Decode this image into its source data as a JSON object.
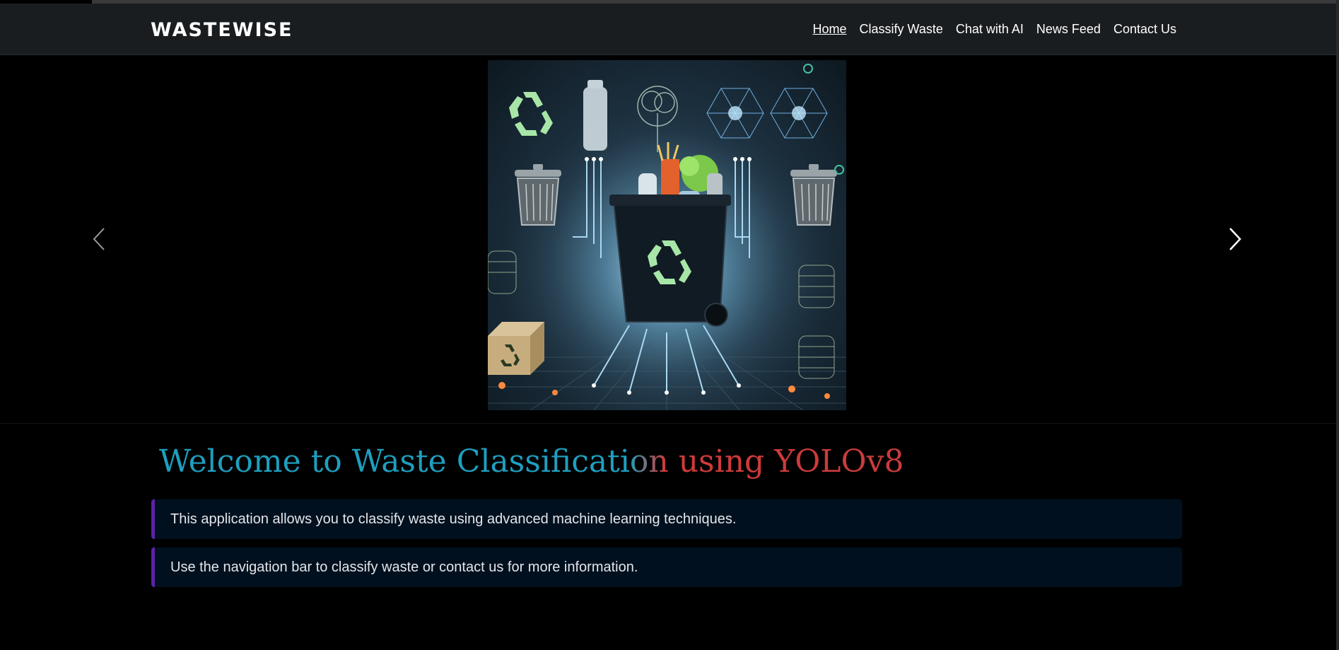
{
  "navbar": {
    "brand": "WASTEWISE",
    "links": [
      {
        "label": "Home",
        "active": true
      },
      {
        "label": "Classify Waste",
        "active": false
      },
      {
        "label": "Chat with AI",
        "active": false
      },
      {
        "label": "News Feed",
        "active": false
      },
      {
        "label": "Contact Us",
        "active": false
      }
    ]
  },
  "carousel": {
    "prev_icon": "chevron-left-icon",
    "next_icon": "chevron-right-icon"
  },
  "main": {
    "title": "Welcome to Waste Classification using YOLOv8",
    "paragraphs": [
      "This application allows you to classify waste using advanced machine learning techniques.",
      "Use the navigation bar to classify waste or contact us for more information."
    ]
  },
  "colors": {
    "navbar_bg": "#1a1d20",
    "title_teal": "#1e9fbf",
    "title_red": "#d23a3a",
    "box_bg": "#00101e",
    "box_accent": "#5a23a8",
    "recycle_green": "#a8e6a8"
  }
}
